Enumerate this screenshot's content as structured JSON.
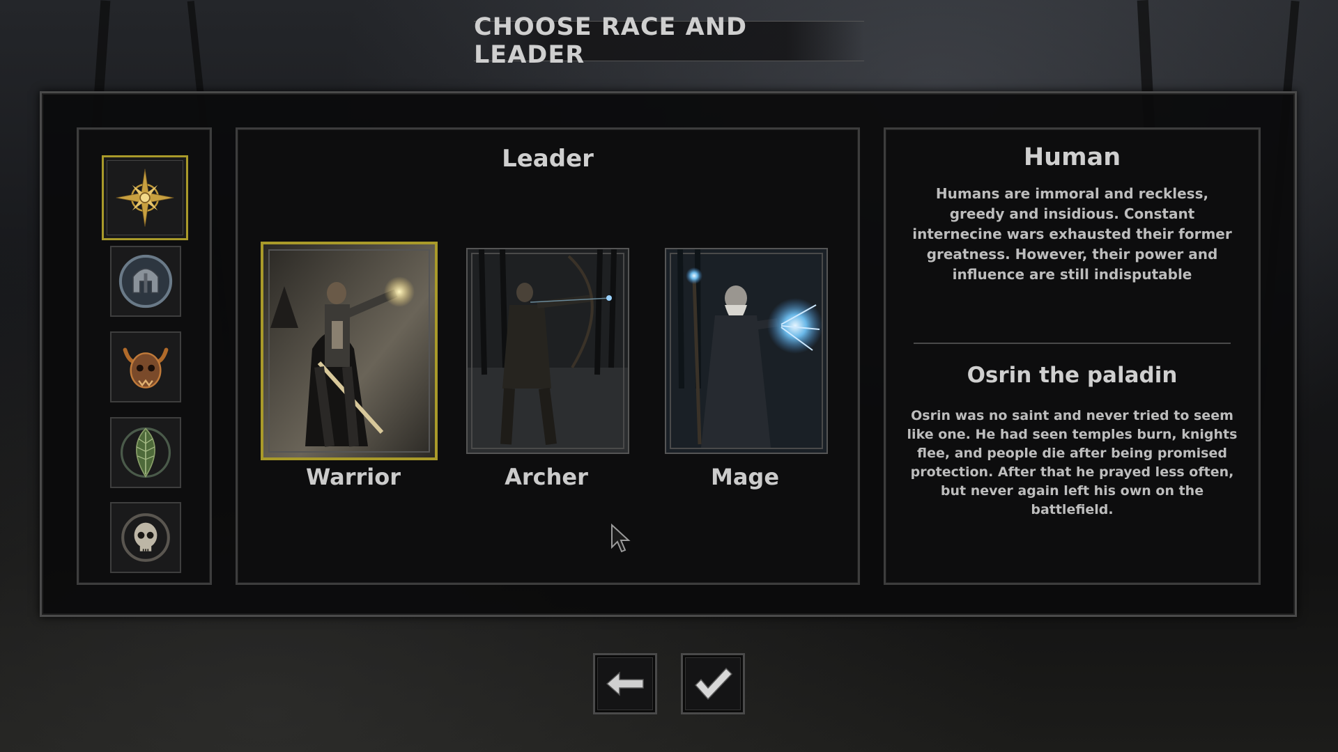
{
  "screen_title": "CHOOSE RACE AND LEADER",
  "races": [
    {
      "icon": "golden-star-emblem-icon",
      "selected": true
    },
    {
      "icon": "dwarf-helmet-emblem-icon",
      "selected": false
    },
    {
      "icon": "horned-demon-skull-emblem-icon",
      "selected": false
    },
    {
      "icon": "leaf-emblem-icon",
      "selected": false
    },
    {
      "icon": "skull-emblem-icon",
      "selected": false
    }
  ],
  "leader": {
    "heading": "Leader",
    "cards": [
      {
        "name": "Warrior",
        "selected": true
      },
      {
        "name": "Archer",
        "selected": false
      },
      {
        "name": "Mage",
        "selected": false
      }
    ]
  },
  "info": {
    "race_name": "Human",
    "race_description": "Humans are immoral and reckless, greedy and insidious. Constant internecine wars exhausted their former greatness. However, their power and influence are still indisputable",
    "leader_name": "Osrin the paladin",
    "leader_description": "Osrin was no saint and never tried to seem like one. He had seen temples burn, knights flee, and people die after being promised protection. After that he prayed less often, but never again left his own on the battlefield."
  },
  "buttons": {
    "back": "back-arrow-icon",
    "confirm": "checkmark-icon"
  },
  "colors": {
    "selection_gold": "#a99a2a",
    "panel_border": "#4a4a4a",
    "text": "#cfcfcf"
  }
}
